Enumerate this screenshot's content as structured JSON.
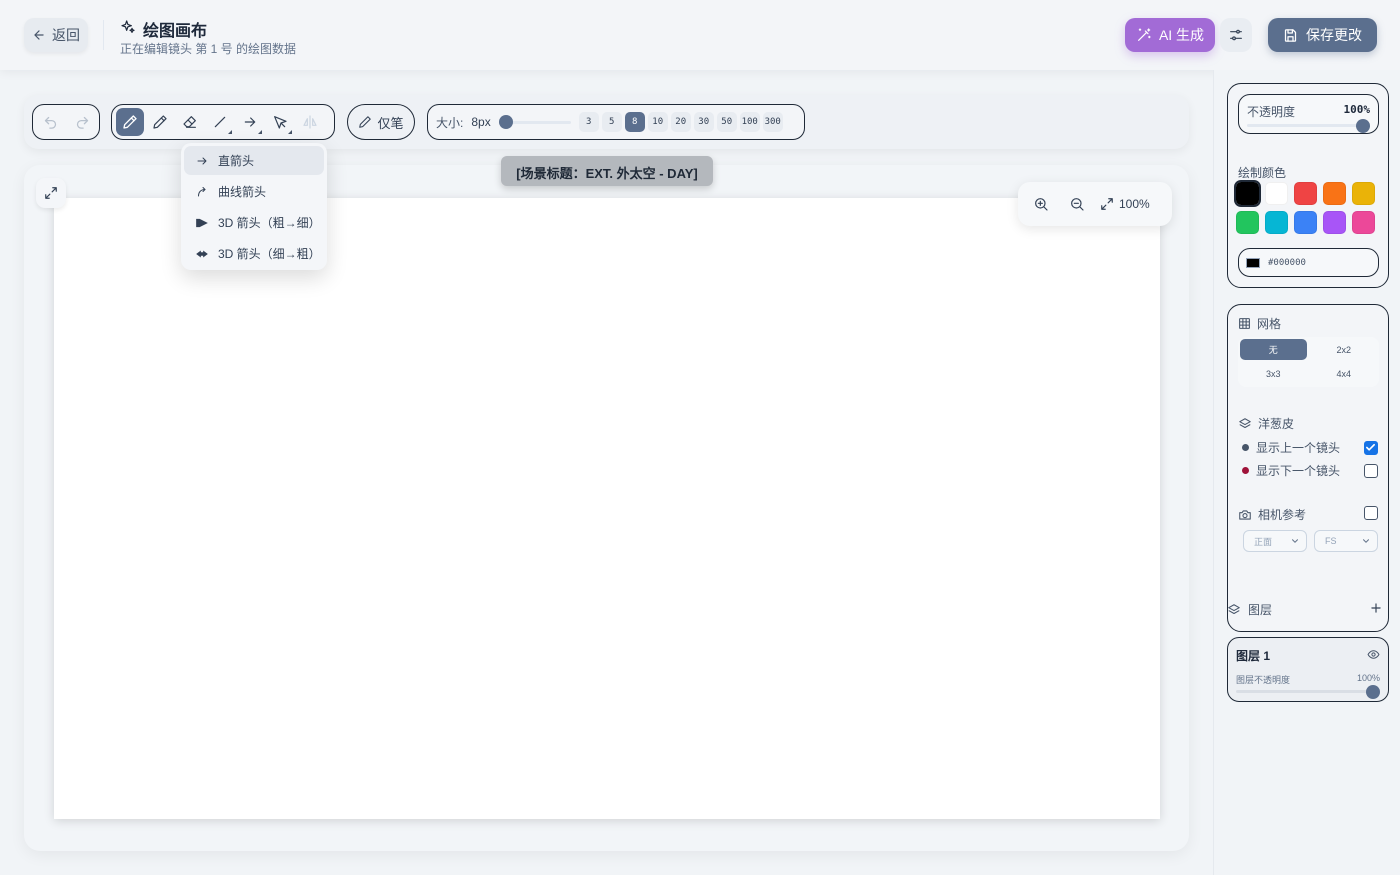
{
  "header": {
    "back_label": "返回",
    "title": "绘图画布",
    "subtitle": "正在编辑镜头 第 1 号 的绘图数据",
    "ai_label": "AI 生成",
    "save_label": "保存更改",
    "icons": [
      "arrow-left-icon",
      "sparkles-icon",
      "wand-icon",
      "sliders-icon",
      "save-icon"
    ],
    "ai_color": "#a26bd6",
    "save_color": "#5b6f8e"
  },
  "toolbar": {
    "tools": [
      {
        "name": "pen",
        "icon": "pencil-icon",
        "active": true
      },
      {
        "name": "pencil",
        "icon": "pencil-outline-icon"
      },
      {
        "name": "eraser",
        "icon": "eraser-icon"
      },
      {
        "name": "line",
        "icon": "line-icon"
      },
      {
        "name": "arrow",
        "icon": "arrow-right-icon"
      },
      {
        "name": "select",
        "icon": "pointer-icon"
      },
      {
        "name": "flip",
        "icon": "flip-icon",
        "disabled": true
      }
    ],
    "pen_only_label": "仅笔",
    "size_label": "大小:",
    "size_value": "8px",
    "size_presets": [
      "3",
      "5",
      "8",
      "10",
      "20",
      "30",
      "50",
      "100",
      "300"
    ],
    "active_size": "8"
  },
  "arrow_menu": {
    "items": [
      {
        "label": "直箭头",
        "icon": "arrow-right-icon",
        "active": true
      },
      {
        "label": "曲线箭头",
        "icon": "curved-arrow-icon"
      },
      {
        "label": "3D 箭头（粗→细）",
        "icon": "arrow-3d-icon"
      },
      {
        "label": "3D 箭头（细→粗）",
        "icon": "arrow-3d-reverse-icon"
      }
    ]
  },
  "canvas": {
    "scene_heading": "[场景标题：EXT. 外太空 - DAY]",
    "zoom_label": "100%",
    "background": "#ffffff"
  },
  "right_panel": {
    "opacity_label": "不透明度",
    "opacity_value": "100%",
    "color_title": "绘制颜色",
    "swatches": [
      "#000000",
      "#ffffff",
      "#ef4444",
      "#f97316",
      "#eab308",
      "#22c55e",
      "#06b6d4",
      "#3b82f6",
      "#a855f7",
      "#ec4899"
    ],
    "selected_color": "#000000",
    "hex_value": "#000000",
    "grid_title": "网格",
    "grid_options": [
      "无",
      "2x2",
      "3x3",
      "4x4"
    ],
    "grid_selected": "无",
    "onion_title": "洋葱皮",
    "onion_prev_label": "显示上一个镜头",
    "onion_next_label": "显示下一个镜头",
    "onion_prev_checked": true,
    "onion_next_checked": false,
    "onion_prev_color": "#475569",
    "onion_next_color": "#9f1239",
    "camera_title": "相机参考",
    "camera_checked": false,
    "camera_angle": "正面",
    "camera_shot": "FS",
    "layers_title": "图层",
    "layers": [
      {
        "name": "图层 1",
        "opacity_label": "图层不透明度",
        "opacity_value": "100%",
        "visible": true
      }
    ]
  }
}
